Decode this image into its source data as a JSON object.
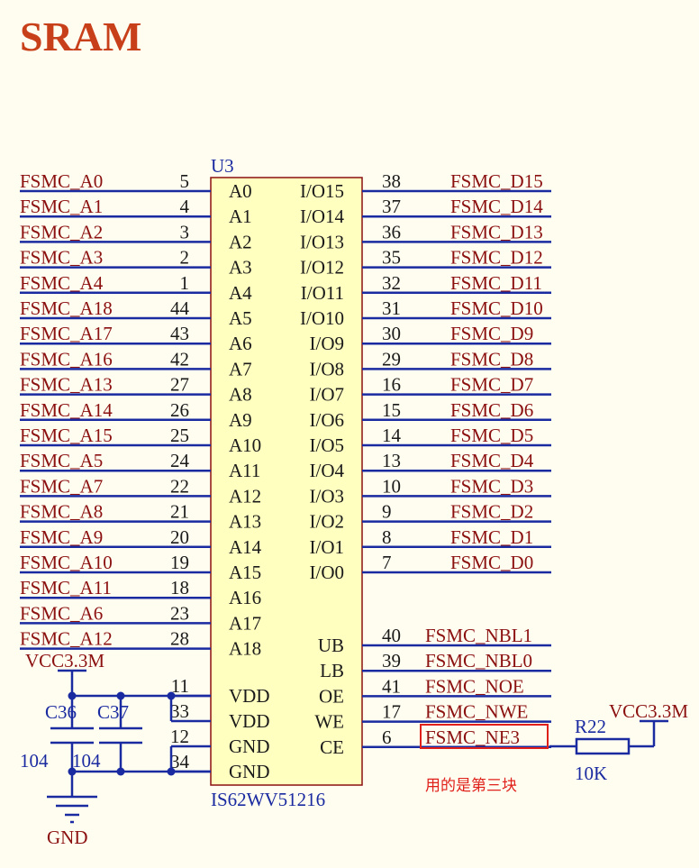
{
  "title": "SRAM",
  "chip": {
    "ref": "U3",
    "part": "IS62WV51216",
    "left_pins": [
      {
        "net": "FSMC_A0",
        "num": "5",
        "name": "A0"
      },
      {
        "net": "FSMC_A1",
        "num": "4",
        "name": "A1"
      },
      {
        "net": "FSMC_A2",
        "num": "3",
        "name": "A2"
      },
      {
        "net": "FSMC_A3",
        "num": "2",
        "name": "A3"
      },
      {
        "net": "FSMC_A4",
        "num": "1",
        "name": "A4"
      },
      {
        "net": "FSMC_A18",
        "num": "44",
        "name": "A5"
      },
      {
        "net": "FSMC_A17",
        "num": "43",
        "name": "A6"
      },
      {
        "net": "FSMC_A16",
        "num": "42",
        "name": "A7"
      },
      {
        "net": "FSMC_A13",
        "num": "27",
        "name": "A8"
      },
      {
        "net": "FSMC_A14",
        "num": "26",
        "name": "A9"
      },
      {
        "net": "FSMC_A15",
        "num": "25",
        "name": "A10"
      },
      {
        "net": "FSMC_A5",
        "num": "24",
        "name": "A11"
      },
      {
        "net": "FSMC_A7",
        "num": "22",
        "name": "A12"
      },
      {
        "net": "FSMC_A8",
        "num": "21",
        "name": "A13"
      },
      {
        "net": "FSMC_A9",
        "num": "20",
        "name": "A14"
      },
      {
        "net": "FSMC_A10",
        "num": "19",
        "name": "A15"
      },
      {
        "net": "FSMC_A11",
        "num": "18",
        "name": "A16"
      },
      {
        "net": "FSMC_A6",
        "num": "23",
        "name": "A17"
      },
      {
        "net": "FSMC_A12",
        "num": "28",
        "name": "A18"
      }
    ],
    "power_pins": [
      {
        "num": "11",
        "name": "VDD"
      },
      {
        "num": "33",
        "name": "VDD"
      },
      {
        "num": "12",
        "name": "GND"
      },
      {
        "num": "34",
        "name": "GND"
      }
    ],
    "right_pins": [
      {
        "net": "FSMC_D15",
        "num": "38",
        "name": "I/O15"
      },
      {
        "net": "FSMC_D14",
        "num": "37",
        "name": "I/O14"
      },
      {
        "net": "FSMC_D13",
        "num": "36",
        "name": "I/O13"
      },
      {
        "net": "FSMC_D12",
        "num": "35",
        "name": "I/O12"
      },
      {
        "net": "FSMC_D11",
        "num": "32",
        "name": "I/O11"
      },
      {
        "net": "FSMC_D10",
        "num": "31",
        "name": "I/O10"
      },
      {
        "net": "FSMC_D9",
        "num": "30",
        "name": "I/O9"
      },
      {
        "net": "FSMC_D8",
        "num": "29",
        "name": "I/O8"
      },
      {
        "net": "FSMC_D7",
        "num": "16",
        "name": "I/O7"
      },
      {
        "net": "FSMC_D6",
        "num": "15",
        "name": "I/O6"
      },
      {
        "net": "FSMC_D5",
        "num": "14",
        "name": "I/O5"
      },
      {
        "net": "FSMC_D4",
        "num": "13",
        "name": "I/O4"
      },
      {
        "net": "FSMC_D3",
        "num": "10",
        "name": "I/O3"
      },
      {
        "net": "FSMC_D2",
        "num": "9",
        "name": "I/O2"
      },
      {
        "net": "FSMC_D1",
        "num": "8",
        "name": "I/O1"
      },
      {
        "net": "FSMC_D0",
        "num": "7",
        "name": "I/O0"
      }
    ],
    "control_pins": [
      {
        "net": "FSMC_NBL1",
        "num": "40",
        "name": "UB"
      },
      {
        "net": "FSMC_NBL0",
        "num": "39",
        "name": "LB"
      },
      {
        "net": "FSMC_NOE",
        "num": "41",
        "name": "OE"
      },
      {
        "net": "FSMC_NWE",
        "num": "17",
        "name": "WE"
      },
      {
        "net": "FSMC_NE3",
        "num": "6",
        "name": "CE"
      }
    ]
  },
  "power": {
    "vcc_left": "VCC3.3M",
    "vcc_right": "VCC3.3M",
    "gnd": "GND",
    "c36_ref": "C36",
    "c36_val": "104",
    "c37_ref": "C37",
    "c37_val": "104",
    "r22_ref": "R22",
    "r22_val": "10K"
  },
  "annotation": "用的是第三块",
  "colors": {
    "title": "#c8401a",
    "net_label": "#8b1010",
    "wire": "#1a2aa0",
    "chip_fill": "#ffffc0",
    "chip_border": "#8b1010",
    "highlight_box": "#e0201a"
  }
}
